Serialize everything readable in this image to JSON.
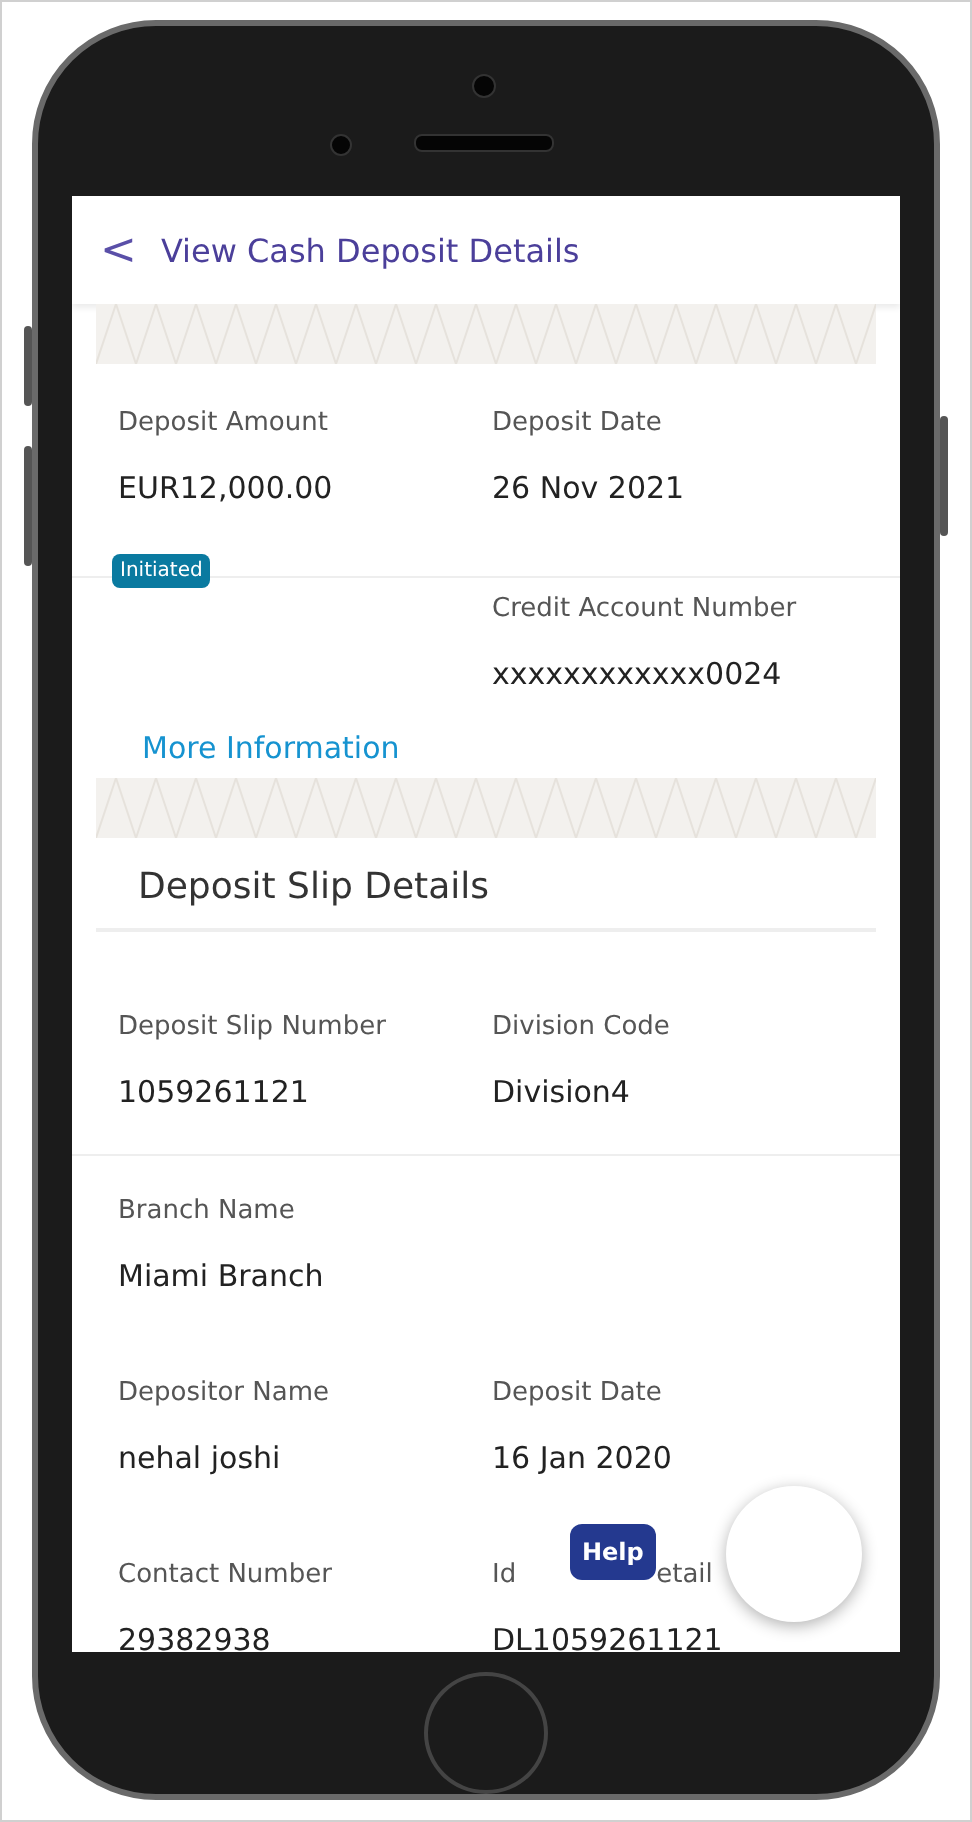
{
  "header": {
    "back": "<",
    "title": "View Cash Deposit Details"
  },
  "summary": {
    "fields": [
      {
        "label": "Deposit Amount",
        "value": "EUR12,000.00"
      },
      {
        "label": "Deposit Date",
        "value": "26 Nov 2021"
      }
    ],
    "status": "Initiated",
    "credit": {
      "label": "Credit Account Number",
      "value": "xxxxxxxxxxxx0024"
    },
    "link": "More Information"
  },
  "slip": {
    "title": "Deposit Slip Details",
    "rows": [
      [
        {
          "label": "Deposit Slip Number",
          "value": "1059261121"
        },
        {
          "label": "Division Code",
          "value": "Division4"
        }
      ],
      [
        {
          "label": "Branch Name",
          "value": "Miami Branch"
        }
      ],
      [
        {
          "label": "Depositor Name",
          "value": "nehal joshi"
        },
        {
          "label": "Deposit Date",
          "value": "16 Jan 2020"
        }
      ],
      [
        {
          "label": "Contact Number",
          "value": "29382938"
        },
        {
          "label": "Id",
          "label_tail": "etail",
          "value": "DL1059261121"
        }
      ]
    ]
  },
  "help": "Help"
}
